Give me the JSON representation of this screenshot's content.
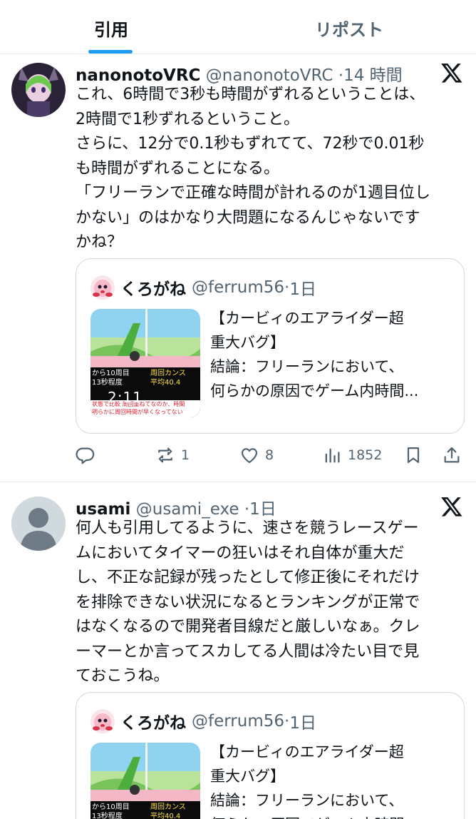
{
  "tabs": [
    {
      "label": "引用",
      "active": true
    },
    {
      "label": "リポスト",
      "active": false
    }
  ],
  "colors": {
    "accent": "#1d9bf0",
    "text": "#0f1419",
    "muted": "#536471",
    "border": "#cfd9de"
  },
  "posts": [
    {
      "name": "nanonotoVRC",
      "handle": "@nanonotoVRC",
      "time": "14 時間",
      "text": "これ、6時間で3秒も時間がずれるということは、\n2時間で1秒ずれるということ。\nさらに、12分で0.1秒もずれてて、72秒で0.01秒\nも時間がずれることになる。\n「フリーランで正確な時間が計れるのが1週目位し\nかない」のはかなり大問題になるんじゃないです\nかね？",
      "quote": {
        "name": "くろがね",
        "handle": "@ferrum56",
        "time": "1日",
        "text_lines": [
          "【カービィのエアライダー超",
          "重大バグ】",
          "結論：フリーランにおいて、",
          "何らかの原因でゲーム内時間..."
        ],
        "video_duration": "2:11",
        "thumb_caption_left": "から10周目",
        "thumb_caption_left2": "13秒程度",
        "thumb_caption_right": "周回カンス",
        "thumb_caption_right2": "平均40.4",
        "thumb_red_1": "状態で比較  周回重ねてなのか、時間",
        "thumb_red_2": "明らかに周回時間が早くなってない"
      },
      "actions": {
        "reply": "",
        "repost": "1",
        "like": "8",
        "views": "1852"
      }
    },
    {
      "name": "usami",
      "handle": "@usami_exe",
      "time": "1日",
      "text": "何人も引用してるように、速さを競うレースゲー\nムにおいてタイマーの狂いはそれ自体が重大だ\nし、不正な記録が残ったとして修正後にそれだけ\nを排除できない状況になるとランキングが正常で\nはなくなるので開発者目線だと厳しいなぁ。クレ\nーマーとか言ってスカしてる人間は冷たい目で見\nておこうね。",
      "quote": {
        "name": "くろがね",
        "handle": "@ferrum56",
        "time": "1日",
        "text_lines": [
          "【カービィのエアライダー超",
          "重大バグ】",
          "結論：フリーランにおいて、",
          "何らかの原因でゲーム内時間"
        ],
        "video_duration": "",
        "thumb_caption_left": "から10周目",
        "thumb_caption_left2": "13秒程度",
        "thumb_caption_right": "周回カンス",
        "thumb_caption_right2": "平均40.4"
      }
    }
  ]
}
